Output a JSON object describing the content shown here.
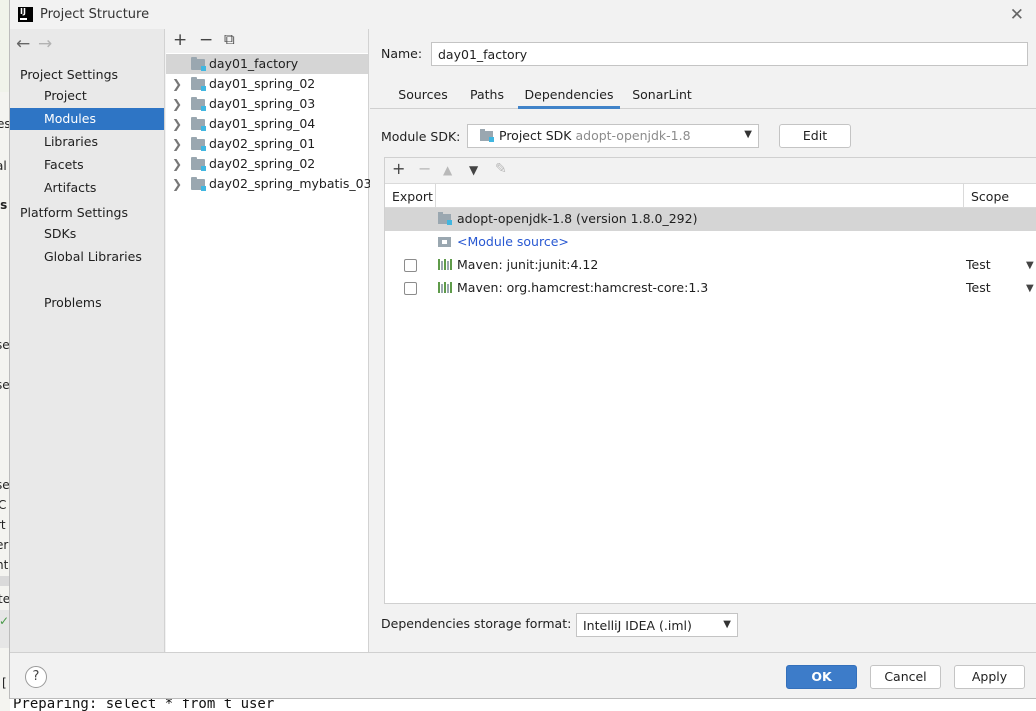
{
  "window": {
    "title": "Project Structure",
    "logo_text": "IJ"
  },
  "nav": {
    "back_icon": "←",
    "forward_icon": "→",
    "project_settings_header": "Project Settings",
    "project_items": [
      "Project",
      "Modules",
      "Libraries",
      "Facets",
      "Artifacts"
    ],
    "platform_settings_header": "Platform Settings",
    "platform_items": [
      "SDKs",
      "Global Libraries"
    ],
    "problems": "Problems",
    "selected": "Modules"
  },
  "modules": {
    "toolbar": {
      "add": "+",
      "remove": "−",
      "copy": "⧉"
    },
    "items": [
      {
        "label": "day01_factory",
        "expandable": false,
        "selected": true
      },
      {
        "label": "day01_spring_02",
        "expandable": true
      },
      {
        "label": "day01_spring_03",
        "expandable": true
      },
      {
        "label": "day01_spring_04",
        "expandable": true
      },
      {
        "label": "day02_spring_01",
        "expandable": true
      },
      {
        "label": "day02_spring_02",
        "expandable": true
      },
      {
        "label": "day02_spring_mybatis_03",
        "expandable": true
      }
    ]
  },
  "detail": {
    "name_label": "Name:",
    "name_value": "day01_factory",
    "tabs": [
      "Sources",
      "Paths",
      "Dependencies",
      "SonarLint"
    ],
    "active_tab": "Dependencies",
    "sdk_label": "Module SDK:",
    "sdk_value": "Project SDK",
    "sdk_sub": "adopt-openjdk-1.8",
    "edit_label": "Edit",
    "dep_toolbar": {
      "add": "+",
      "remove": "−",
      "up": "▲",
      "down": "▼",
      "edit": "✎"
    },
    "columns": {
      "export": "Export",
      "scope": "Scope"
    },
    "dependencies": [
      {
        "label": "adopt-openjdk-1.8 (version 1.8.0_292)",
        "icon": "jdk-folder-icon",
        "checkbox": false,
        "scope": ""
      },
      {
        "label": "<Module source>",
        "icon": "module-source-icon",
        "checkbox": false,
        "scope": ""
      },
      {
        "label": "Maven: junit:junit:4.12",
        "icon": "library-icon",
        "checkbox": true,
        "scope": "Test"
      },
      {
        "label": "Maven: org.hamcrest:hamcrest-core:1.3",
        "icon": "library-icon",
        "checkbox": true,
        "scope": "Test"
      }
    ],
    "storage_label": "Dependencies storage format:",
    "storage_value": "IntelliJ IDEA (.iml)"
  },
  "footer": {
    "help": "?",
    "ok": "OK",
    "cancel": "Cancel",
    "apply": "Apply"
  },
  "background": {
    "console_line": "Preparing: select * from t_user",
    "left_fragments": [
      "es",
      "al",
      "is",
      "se",
      "se",
      "se",
      "C",
      "rt",
      "er",
      "nt",
      "te",
      "✓",
      "["
    ]
  },
  "colors": {
    "accent": "#2e75c5",
    "primary_button": "#3d7cc9",
    "link": "#2858d2",
    "library_icon": "#5f9b4a"
  }
}
